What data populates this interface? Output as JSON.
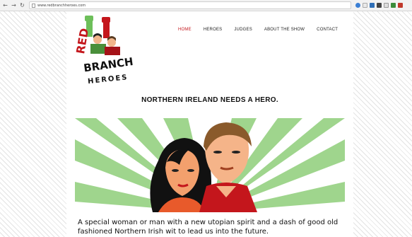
{
  "browser": {
    "back_icon": "back-arrow-icon",
    "forward_icon": "forward-arrow-icon",
    "reload_icon": "reload-icon",
    "url": "www.redbranchheroes.com"
  },
  "site": {
    "logo": {
      "line1": "RED",
      "line2": "BRANCH",
      "line3": "HEROES"
    },
    "nav": [
      {
        "label": "HOME",
        "active": true
      },
      {
        "label": "HEROES",
        "active": false
      },
      {
        "label": "JUDGES",
        "active": false
      },
      {
        "label": "ABOUT THE SHOW",
        "active": false
      },
      {
        "label": "CONTACT",
        "active": false
      }
    ],
    "headline": "NORTHERN IRELAND NEEDS A HERO.",
    "tagline": "A special woman or man with a new utopian spirit and a dash of good old fashioned Northern Irish wit to lead us into the future."
  },
  "colors": {
    "brand_red": "#c4161c",
    "hero_green": "#9fd58d",
    "stripe": "#e3e3e3"
  }
}
